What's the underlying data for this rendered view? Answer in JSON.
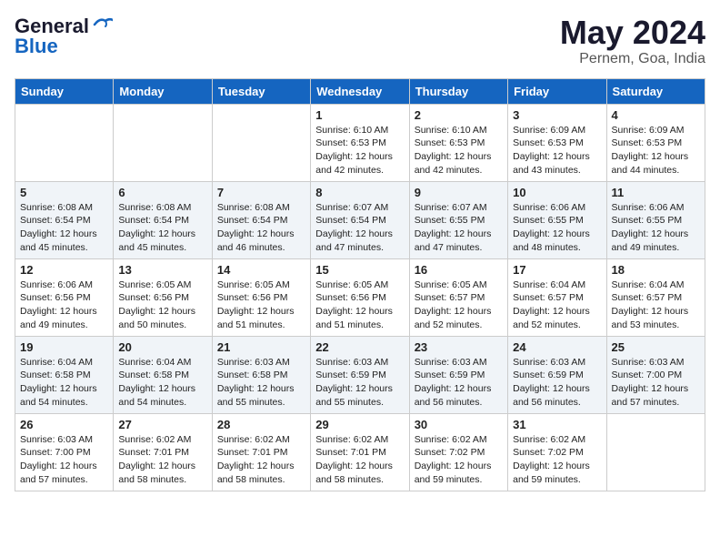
{
  "header": {
    "logo_general": "General",
    "logo_blue": "Blue",
    "month_title": "May 2024",
    "location": "Pernem, Goa, India"
  },
  "weekdays": [
    "Sunday",
    "Monday",
    "Tuesday",
    "Wednesday",
    "Thursday",
    "Friday",
    "Saturday"
  ],
  "weeks": [
    [
      {
        "day": "",
        "info": ""
      },
      {
        "day": "",
        "info": ""
      },
      {
        "day": "",
        "info": ""
      },
      {
        "day": "1",
        "info": "Sunrise: 6:10 AM\nSunset: 6:53 PM\nDaylight: 12 hours and 42 minutes."
      },
      {
        "day": "2",
        "info": "Sunrise: 6:10 AM\nSunset: 6:53 PM\nDaylight: 12 hours and 42 minutes."
      },
      {
        "day": "3",
        "info": "Sunrise: 6:09 AM\nSunset: 6:53 PM\nDaylight: 12 hours and 43 minutes."
      },
      {
        "day": "4",
        "info": "Sunrise: 6:09 AM\nSunset: 6:53 PM\nDaylight: 12 hours and 44 minutes."
      }
    ],
    [
      {
        "day": "5",
        "info": "Sunrise: 6:08 AM\nSunset: 6:54 PM\nDaylight: 12 hours and 45 minutes."
      },
      {
        "day": "6",
        "info": "Sunrise: 6:08 AM\nSunset: 6:54 PM\nDaylight: 12 hours and 45 minutes."
      },
      {
        "day": "7",
        "info": "Sunrise: 6:08 AM\nSunset: 6:54 PM\nDaylight: 12 hours and 46 minutes."
      },
      {
        "day": "8",
        "info": "Sunrise: 6:07 AM\nSunset: 6:54 PM\nDaylight: 12 hours and 47 minutes."
      },
      {
        "day": "9",
        "info": "Sunrise: 6:07 AM\nSunset: 6:55 PM\nDaylight: 12 hours and 47 minutes."
      },
      {
        "day": "10",
        "info": "Sunrise: 6:06 AM\nSunset: 6:55 PM\nDaylight: 12 hours and 48 minutes."
      },
      {
        "day": "11",
        "info": "Sunrise: 6:06 AM\nSunset: 6:55 PM\nDaylight: 12 hours and 49 minutes."
      }
    ],
    [
      {
        "day": "12",
        "info": "Sunrise: 6:06 AM\nSunset: 6:56 PM\nDaylight: 12 hours and 49 minutes."
      },
      {
        "day": "13",
        "info": "Sunrise: 6:05 AM\nSunset: 6:56 PM\nDaylight: 12 hours and 50 minutes."
      },
      {
        "day": "14",
        "info": "Sunrise: 6:05 AM\nSunset: 6:56 PM\nDaylight: 12 hours and 51 minutes."
      },
      {
        "day": "15",
        "info": "Sunrise: 6:05 AM\nSunset: 6:56 PM\nDaylight: 12 hours and 51 minutes."
      },
      {
        "day": "16",
        "info": "Sunrise: 6:05 AM\nSunset: 6:57 PM\nDaylight: 12 hours and 52 minutes."
      },
      {
        "day": "17",
        "info": "Sunrise: 6:04 AM\nSunset: 6:57 PM\nDaylight: 12 hours and 52 minutes."
      },
      {
        "day": "18",
        "info": "Sunrise: 6:04 AM\nSunset: 6:57 PM\nDaylight: 12 hours and 53 minutes."
      }
    ],
    [
      {
        "day": "19",
        "info": "Sunrise: 6:04 AM\nSunset: 6:58 PM\nDaylight: 12 hours and 54 minutes."
      },
      {
        "day": "20",
        "info": "Sunrise: 6:04 AM\nSunset: 6:58 PM\nDaylight: 12 hours and 54 minutes."
      },
      {
        "day": "21",
        "info": "Sunrise: 6:03 AM\nSunset: 6:58 PM\nDaylight: 12 hours and 55 minutes."
      },
      {
        "day": "22",
        "info": "Sunrise: 6:03 AM\nSunset: 6:59 PM\nDaylight: 12 hours and 55 minutes."
      },
      {
        "day": "23",
        "info": "Sunrise: 6:03 AM\nSunset: 6:59 PM\nDaylight: 12 hours and 56 minutes."
      },
      {
        "day": "24",
        "info": "Sunrise: 6:03 AM\nSunset: 6:59 PM\nDaylight: 12 hours and 56 minutes."
      },
      {
        "day": "25",
        "info": "Sunrise: 6:03 AM\nSunset: 7:00 PM\nDaylight: 12 hours and 57 minutes."
      }
    ],
    [
      {
        "day": "26",
        "info": "Sunrise: 6:03 AM\nSunset: 7:00 PM\nDaylight: 12 hours and 57 minutes."
      },
      {
        "day": "27",
        "info": "Sunrise: 6:02 AM\nSunset: 7:01 PM\nDaylight: 12 hours and 58 minutes."
      },
      {
        "day": "28",
        "info": "Sunrise: 6:02 AM\nSunset: 7:01 PM\nDaylight: 12 hours and 58 minutes."
      },
      {
        "day": "29",
        "info": "Sunrise: 6:02 AM\nSunset: 7:01 PM\nDaylight: 12 hours and 58 minutes."
      },
      {
        "day": "30",
        "info": "Sunrise: 6:02 AM\nSunset: 7:02 PM\nDaylight: 12 hours and 59 minutes."
      },
      {
        "day": "31",
        "info": "Sunrise: 6:02 AM\nSunset: 7:02 PM\nDaylight: 12 hours and 59 minutes."
      },
      {
        "day": "",
        "info": ""
      }
    ]
  ]
}
